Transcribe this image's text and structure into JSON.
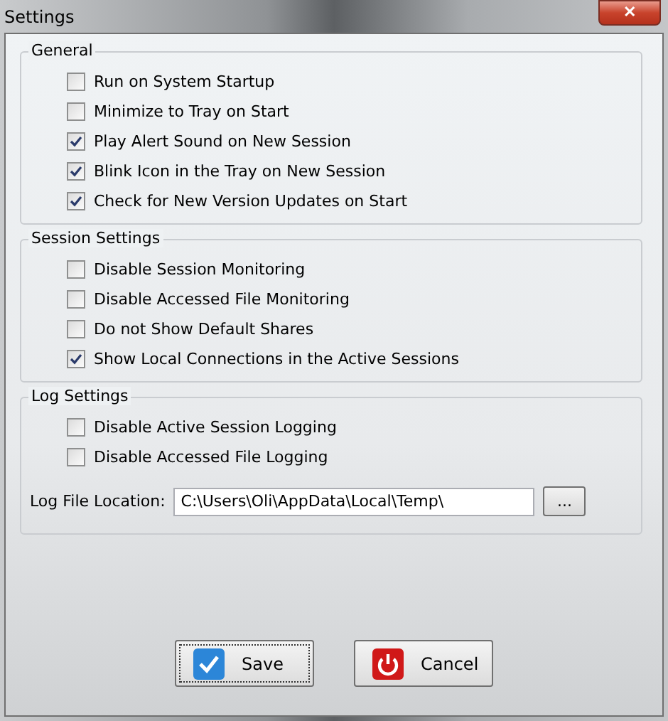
{
  "window": {
    "title": "Settings",
    "close": "✕"
  },
  "groups": [
    {
      "title": "General",
      "options": [
        {
          "label": "Run on System Startup",
          "checked": false
        },
        {
          "label": "Minimize to Tray on Start",
          "checked": false
        },
        {
          "label": "Play Alert Sound on New Session",
          "checked": true
        },
        {
          "label": "Blink Icon in the Tray on New Session",
          "checked": true
        },
        {
          "label": "Check for New Version Updates on Start",
          "checked": true
        }
      ]
    },
    {
      "title": "Session Settings",
      "options": [
        {
          "label": "Disable Session Monitoring",
          "checked": false
        },
        {
          "label": "Disable Accessed File Monitoring",
          "checked": false
        },
        {
          "label": "Do not Show Default Shares",
          "checked": false
        },
        {
          "label": "Show Local Connections in the Active Sessions",
          "checked": true
        }
      ]
    },
    {
      "title": "Log Settings",
      "options": [
        {
          "label": "Disable Active Session Logging",
          "checked": false
        },
        {
          "label": "Disable Accessed File Logging",
          "checked": false
        }
      ],
      "field": {
        "label": "Log File Location:",
        "value": "C:\\Users\\Oli\\AppData\\Local\\Temp\\",
        "browse": "..."
      }
    }
  ],
  "buttons": [
    {
      "label": "Save",
      "kind": "save"
    },
    {
      "label": "Cancel",
      "kind": "cancel"
    }
  ]
}
